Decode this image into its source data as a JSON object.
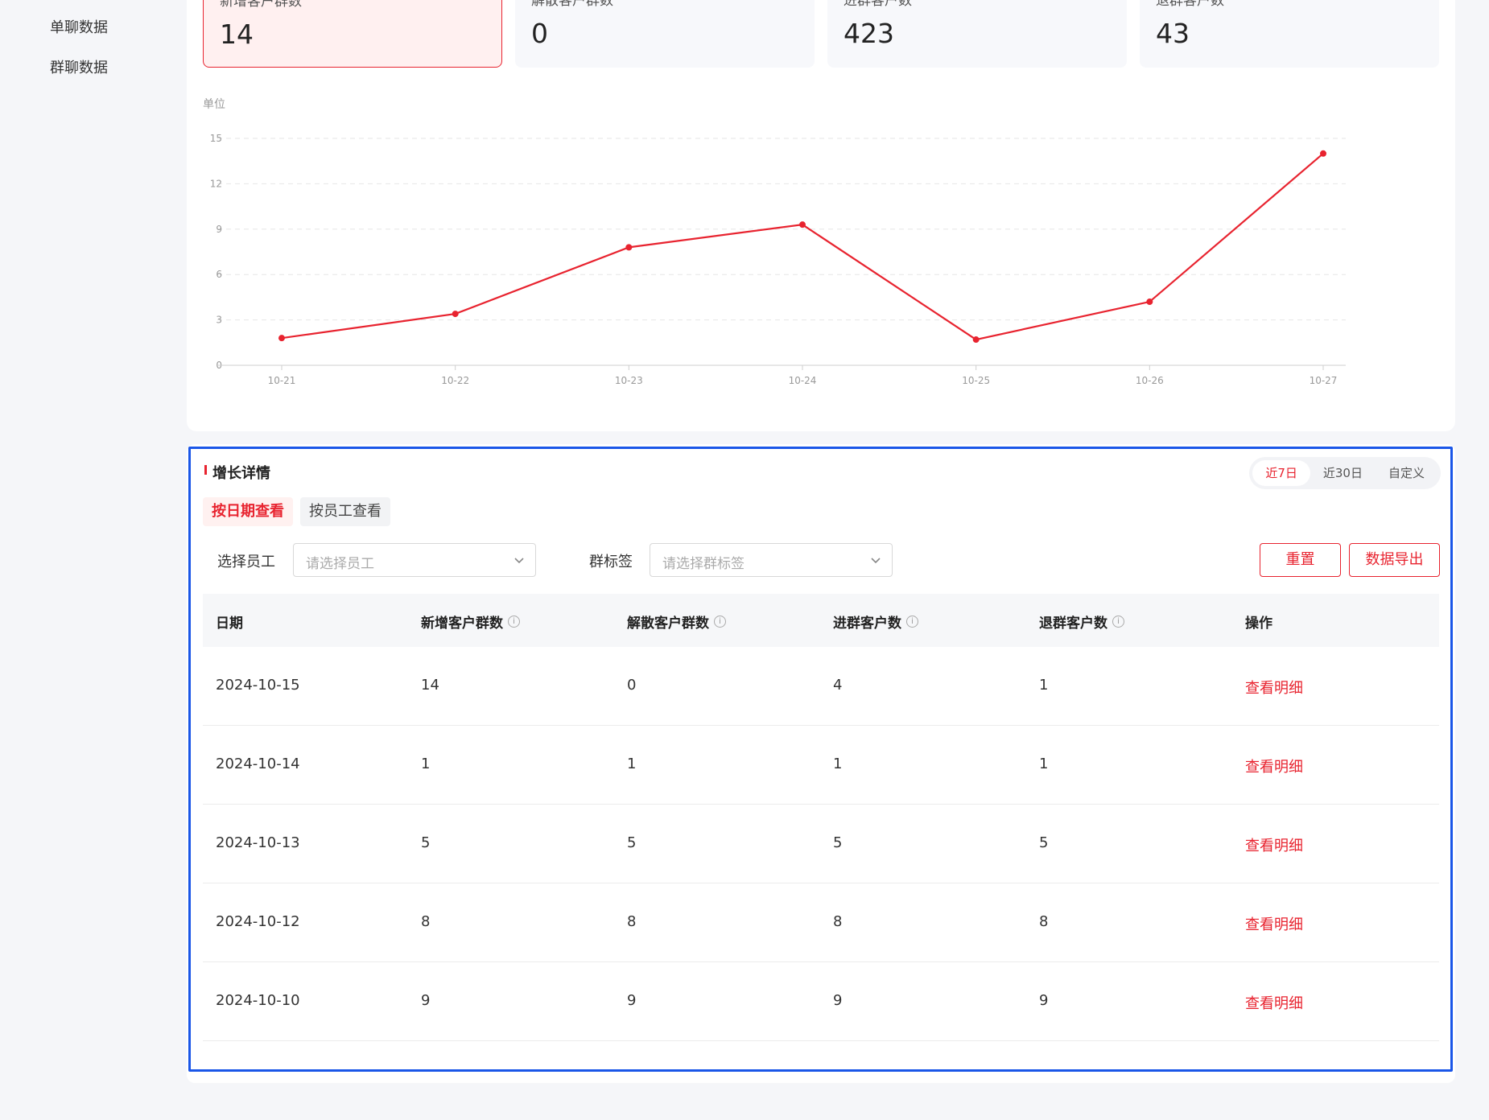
{
  "sidebar": {
    "items": [
      {
        "label": "单聊数据"
      },
      {
        "label": "群聊数据"
      }
    ]
  },
  "stats": [
    {
      "label": "新增客户群数",
      "value": "14"
    },
    {
      "label": "解散客户群数",
      "value": "0"
    },
    {
      "label": "进群客户数",
      "value": "423"
    },
    {
      "label": "退群客户数",
      "value": "43"
    }
  ],
  "chart_data": {
    "type": "line",
    "ylabel": "单位",
    "categories": [
      "10-21",
      "10-22",
      "10-23",
      "10-24",
      "10-25",
      "10-26",
      "10-27"
    ],
    "values": [
      1.8,
      3.4,
      7.8,
      9.3,
      1.7,
      4.2,
      14
    ],
    "ylim": [
      0,
      15
    ],
    "yticks": [
      0,
      3,
      6,
      9,
      12,
      15
    ],
    "grid": true,
    "color": "#e8232f"
  },
  "detail": {
    "title": "增长详情",
    "ranges": [
      {
        "label": "近7日"
      },
      {
        "label": "近30日"
      },
      {
        "label": "自定义"
      }
    ],
    "tabs": [
      {
        "label": "按日期查看"
      },
      {
        "label": "按员工查看"
      }
    ],
    "filters": {
      "staff_label": "选择员工",
      "staff_placeholder": "请选择员工",
      "tag_label": "群标签",
      "tag_placeholder": "请选择群标签"
    },
    "buttons": {
      "reset": "重置",
      "export": "数据导出"
    },
    "columns": [
      "日期",
      "新增客户群数",
      "解散客户群数",
      "进群客户数",
      "退群客户数",
      "操作"
    ],
    "rows": [
      {
        "date": "2024-10-15",
        "new": "14",
        "dissolved": "0",
        "joined": "4",
        "left": "1",
        "action": "查看明细"
      },
      {
        "date": "2024-10-14",
        "new": "1",
        "dissolved": "1",
        "joined": "1",
        "left": "1",
        "action": "查看明细"
      },
      {
        "date": "2024-10-13",
        "new": "5",
        "dissolved": "5",
        "joined": "5",
        "left": "5",
        "action": "查看明细"
      },
      {
        "date": "2024-10-12",
        "new": "8",
        "dissolved": "8",
        "joined": "8",
        "left": "8",
        "action": "查看明细"
      },
      {
        "date": "2024-10-10",
        "new": "9",
        "dissolved": "9",
        "joined": "9",
        "left": "9",
        "action": "查看明细"
      }
    ]
  }
}
